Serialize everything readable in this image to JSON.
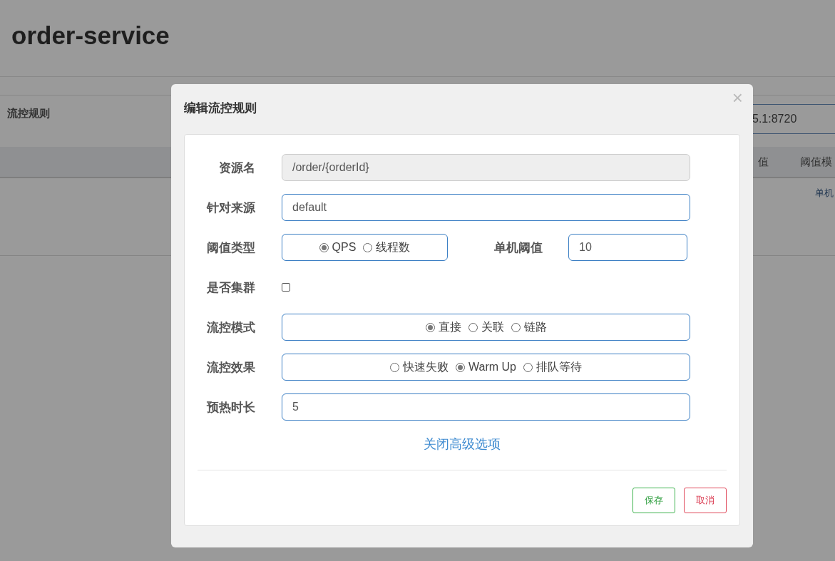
{
  "page": {
    "title": "order-service",
    "section": "流控规则",
    "address_field": {
      "value": "5.1:8720"
    },
    "table_columns": [
      "值",
      "阈值模"
    ],
    "table_rows": [
      [
        "单机"
      ]
    ]
  },
  "dialog": {
    "title": "编辑流控规则",
    "close": "×",
    "fields": [
      {
        "kind": "text",
        "label": "资源名",
        "value": "/order/{orderId}",
        "disabled": true
      },
      {
        "kind": "text",
        "label": "针对来源",
        "value": "default",
        "disabled": false
      },
      {
        "kind": "radio",
        "label": "阈值类型",
        "options": [
          {
            "label": "QPS",
            "selected": true
          },
          {
            "label": "线程数",
            "selected": false
          }
        ],
        "aside": {
          "label": "单机阈值",
          "value": "10"
        }
      },
      {
        "kind": "checkbox",
        "label": "是否集群",
        "checked": false
      },
      {
        "kind": "radio",
        "label": "流控模式",
        "options": [
          {
            "label": "直接",
            "selected": true
          },
          {
            "label": "关联",
            "selected": false
          },
          {
            "label": "链路",
            "selected": false
          }
        ]
      },
      {
        "kind": "radio",
        "label": "流控效果",
        "options": [
          {
            "label": "快速失败",
            "selected": false
          },
          {
            "label": "Warm Up",
            "selected": true
          },
          {
            "label": "排队等待",
            "selected": false
          }
        ]
      },
      {
        "kind": "text",
        "label": "预热时长",
        "value": "5",
        "disabled": false
      }
    ],
    "advanced_link": "关闭高级选项",
    "buttons": [
      {
        "label": "保存",
        "kind": "save"
      },
      {
        "label": "取消",
        "kind": "cancel"
      }
    ]
  }
}
